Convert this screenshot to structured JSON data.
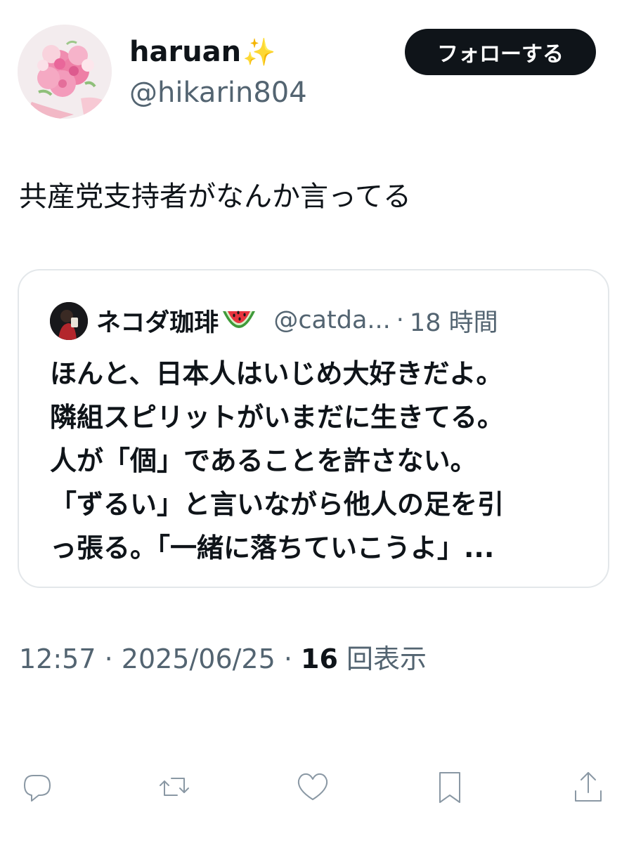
{
  "author": {
    "display_name": "haruan",
    "sparkle": "✨",
    "handle": "@hikarin804",
    "avatar_icon": "flower-bouquet-avatar"
  },
  "follow_button": {
    "label": "フォローする"
  },
  "tweet": {
    "text": "共産党支持者がなんか言ってる"
  },
  "quoted_tweet": {
    "name": "ネコダ珈琲",
    "name_emoji": "watermelon-emoji",
    "handle": "@catda...",
    "separator": "·",
    "time": "18 時間",
    "lines": [
      "ほんと、日本人はいじめ大好きだよ。",
      "隣組スピリットがいまだに生きてる。",
      "人が「個」であることを許さない。",
      "「ずるい」と言いながら他人の足を引",
      "っ張る。「一緒に落ちていこうよ」..."
    ]
  },
  "meta": {
    "time": "12:57",
    "sep1": " · ",
    "date": "2025/06/25",
    "sep2": " · ",
    "views_count": "16",
    "views_label": " 回表示"
  },
  "actions": {
    "reply_icon": "reply-icon",
    "retweet_icon": "retweet-icon",
    "like_icon": "heart-icon",
    "bookmark_icon": "bookmark-icon",
    "share_icon": "share-icon"
  },
  "colors": {
    "text": "#0f1419",
    "secondary": "#536471",
    "button_bg": "#0f1419",
    "icon": "#8a98a4",
    "border": "#e3e7ea"
  }
}
